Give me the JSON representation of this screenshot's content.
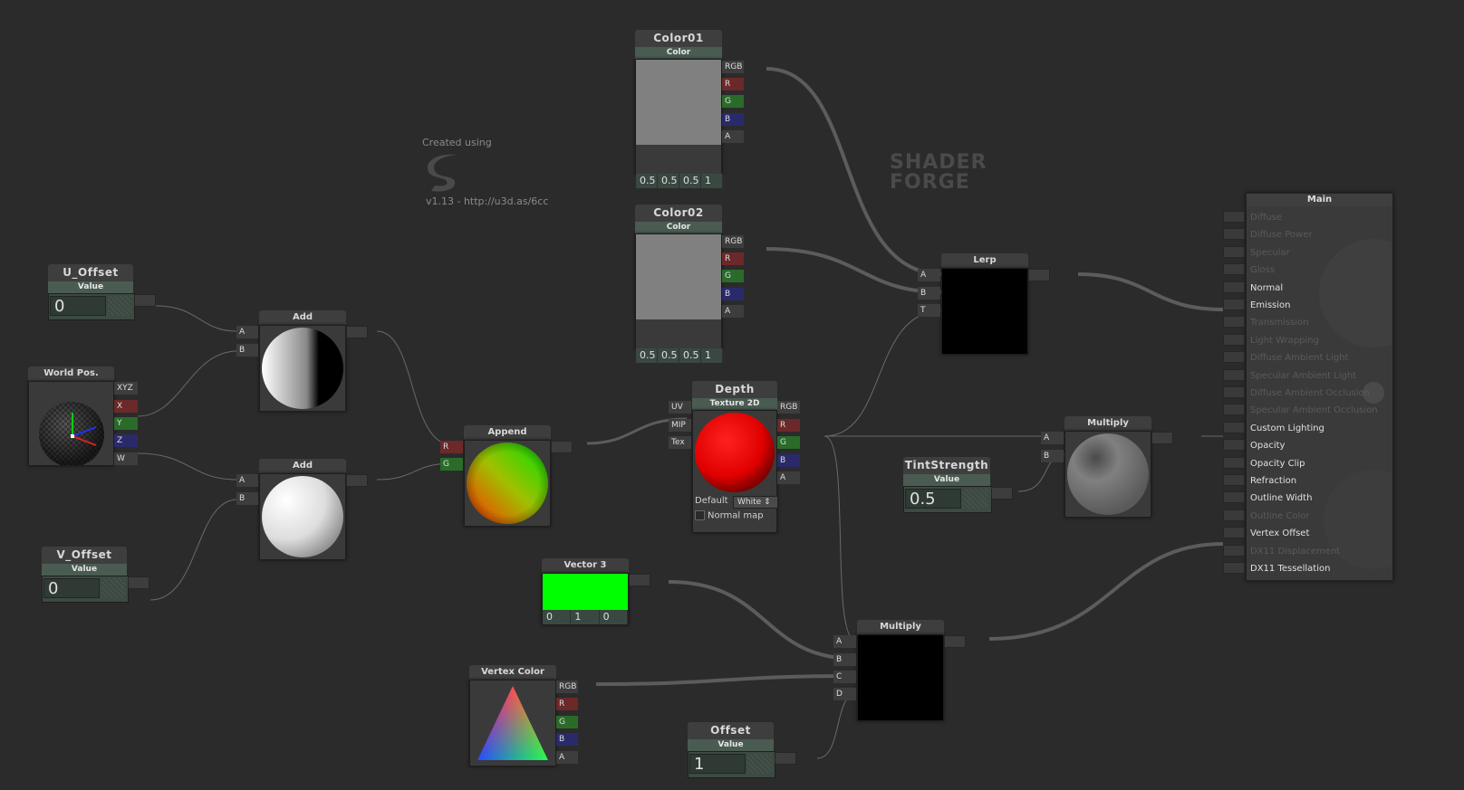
{
  "watermark": {
    "created": "Created using",
    "line1": "SHADER",
    "line2": "FORGE",
    "version": "v1.13 - http://u3d.as/6cc"
  },
  "nodes": {
    "color01": {
      "title": "Color01",
      "sub": "Color",
      "vals": [
        "0.5",
        "0.5",
        "0.5",
        "1"
      ],
      "outs": [
        "RGB",
        "R",
        "G",
        "B",
        "A"
      ]
    },
    "color02": {
      "title": "Color02",
      "sub": "Color",
      "vals": [
        "0.5",
        "0.5",
        "0.5",
        "1"
      ],
      "outs": [
        "RGB",
        "R",
        "G",
        "B",
        "A"
      ]
    },
    "u_offset": {
      "title": "U_Offset",
      "sub": "Value",
      "value": "0"
    },
    "v_offset": {
      "title": "V_Offset",
      "sub": "Value",
      "value": "0"
    },
    "world_pos": {
      "title": "World Pos.",
      "outs": [
        "XYZ",
        "X",
        "Y",
        "Z",
        "W"
      ]
    },
    "add1": {
      "title": "Add",
      "ins": [
        "A",
        "B"
      ]
    },
    "add2": {
      "title": "Add",
      "ins": [
        "A",
        "B"
      ]
    },
    "append": {
      "title": "Append",
      "ins": [
        "R",
        "G"
      ]
    },
    "depth": {
      "title": "Depth",
      "sub": "Texture 2D",
      "ins": [
        "UV",
        "MIP",
        "Tex"
      ],
      "outs": [
        "RGB",
        "R",
        "G",
        "B",
        "A"
      ],
      "default_label": "Default",
      "default_value": "White",
      "normal_map": "Normal map"
    },
    "lerp": {
      "title": "Lerp",
      "ins": [
        "A",
        "B",
        "T"
      ]
    },
    "tint": {
      "title": "TintStrength",
      "sub": "Value",
      "value": "0.5"
    },
    "multiply1": {
      "title": "Multiply",
      "ins": [
        "A",
        "B"
      ]
    },
    "vector3": {
      "title": "Vector 3",
      "vals": [
        "0",
        "1",
        "0"
      ]
    },
    "vertex_color": {
      "title": "Vertex Color",
      "outs": [
        "RGB",
        "R",
        "G",
        "B",
        "A"
      ]
    },
    "offset": {
      "title": "Offset",
      "sub": "Value",
      "value": "1"
    },
    "multiply2": {
      "title": "Multiply",
      "ins": [
        "A",
        "B",
        "C",
        "D"
      ]
    }
  },
  "main": {
    "title": "Main",
    "inputs": [
      {
        "label": "Diffuse",
        "active": false
      },
      {
        "label": "Diffuse Power",
        "active": false
      },
      {
        "label": "Specular",
        "active": false
      },
      {
        "label": "Gloss",
        "active": false
      },
      {
        "label": "Normal",
        "active": true
      },
      {
        "label": "Emission",
        "active": true
      },
      {
        "label": "Transmission",
        "active": false
      },
      {
        "label": "Light Wrapping",
        "active": false
      },
      {
        "label": "Diffuse Ambient Light",
        "active": false
      },
      {
        "label": "Specular Ambient Light",
        "active": false
      },
      {
        "label": "Diffuse Ambient Occlusion",
        "active": false
      },
      {
        "label": "Specular Ambient Occlusion",
        "active": false
      },
      {
        "label": "Custom Lighting",
        "active": true
      },
      {
        "label": "Opacity",
        "active": true
      },
      {
        "label": "Opacity Clip",
        "active": true
      },
      {
        "label": "Refraction",
        "active": true
      },
      {
        "label": "Outline Width",
        "active": true
      },
      {
        "label": "Outline Color",
        "active": false
      },
      {
        "label": "Vertex Offset",
        "active": true
      },
      {
        "label": "DX11 Displacement",
        "active": false
      },
      {
        "label": "DX11 Tessellation",
        "active": true
      }
    ]
  }
}
